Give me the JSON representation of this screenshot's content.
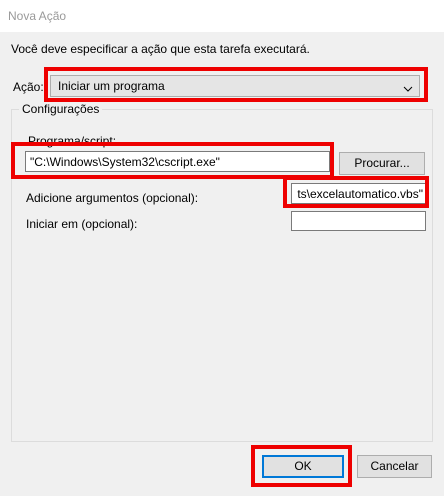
{
  "window": {
    "title": "Nova Ação"
  },
  "instruction": "Você deve especificar a ação que esta tarefa executará.",
  "action": {
    "label": "Ação:",
    "selected": "Iniciar um programa"
  },
  "settings": {
    "legend": "Configurações",
    "program_label": "Programa/script:",
    "program_value": "\"C:\\Windows\\System32\\cscript.exe\"",
    "browse_label": "Procurar...",
    "args_label": "Adicione argumentos (opcional):",
    "args_value": "ts\\excelautomatico.vbs\"",
    "start_in_label": "Iniciar em (opcional):",
    "start_in_value": ""
  },
  "buttons": {
    "ok": "OK",
    "cancel": "Cancelar"
  },
  "colors": {
    "highlight": "#ee0000",
    "focus": "#0078d7"
  }
}
